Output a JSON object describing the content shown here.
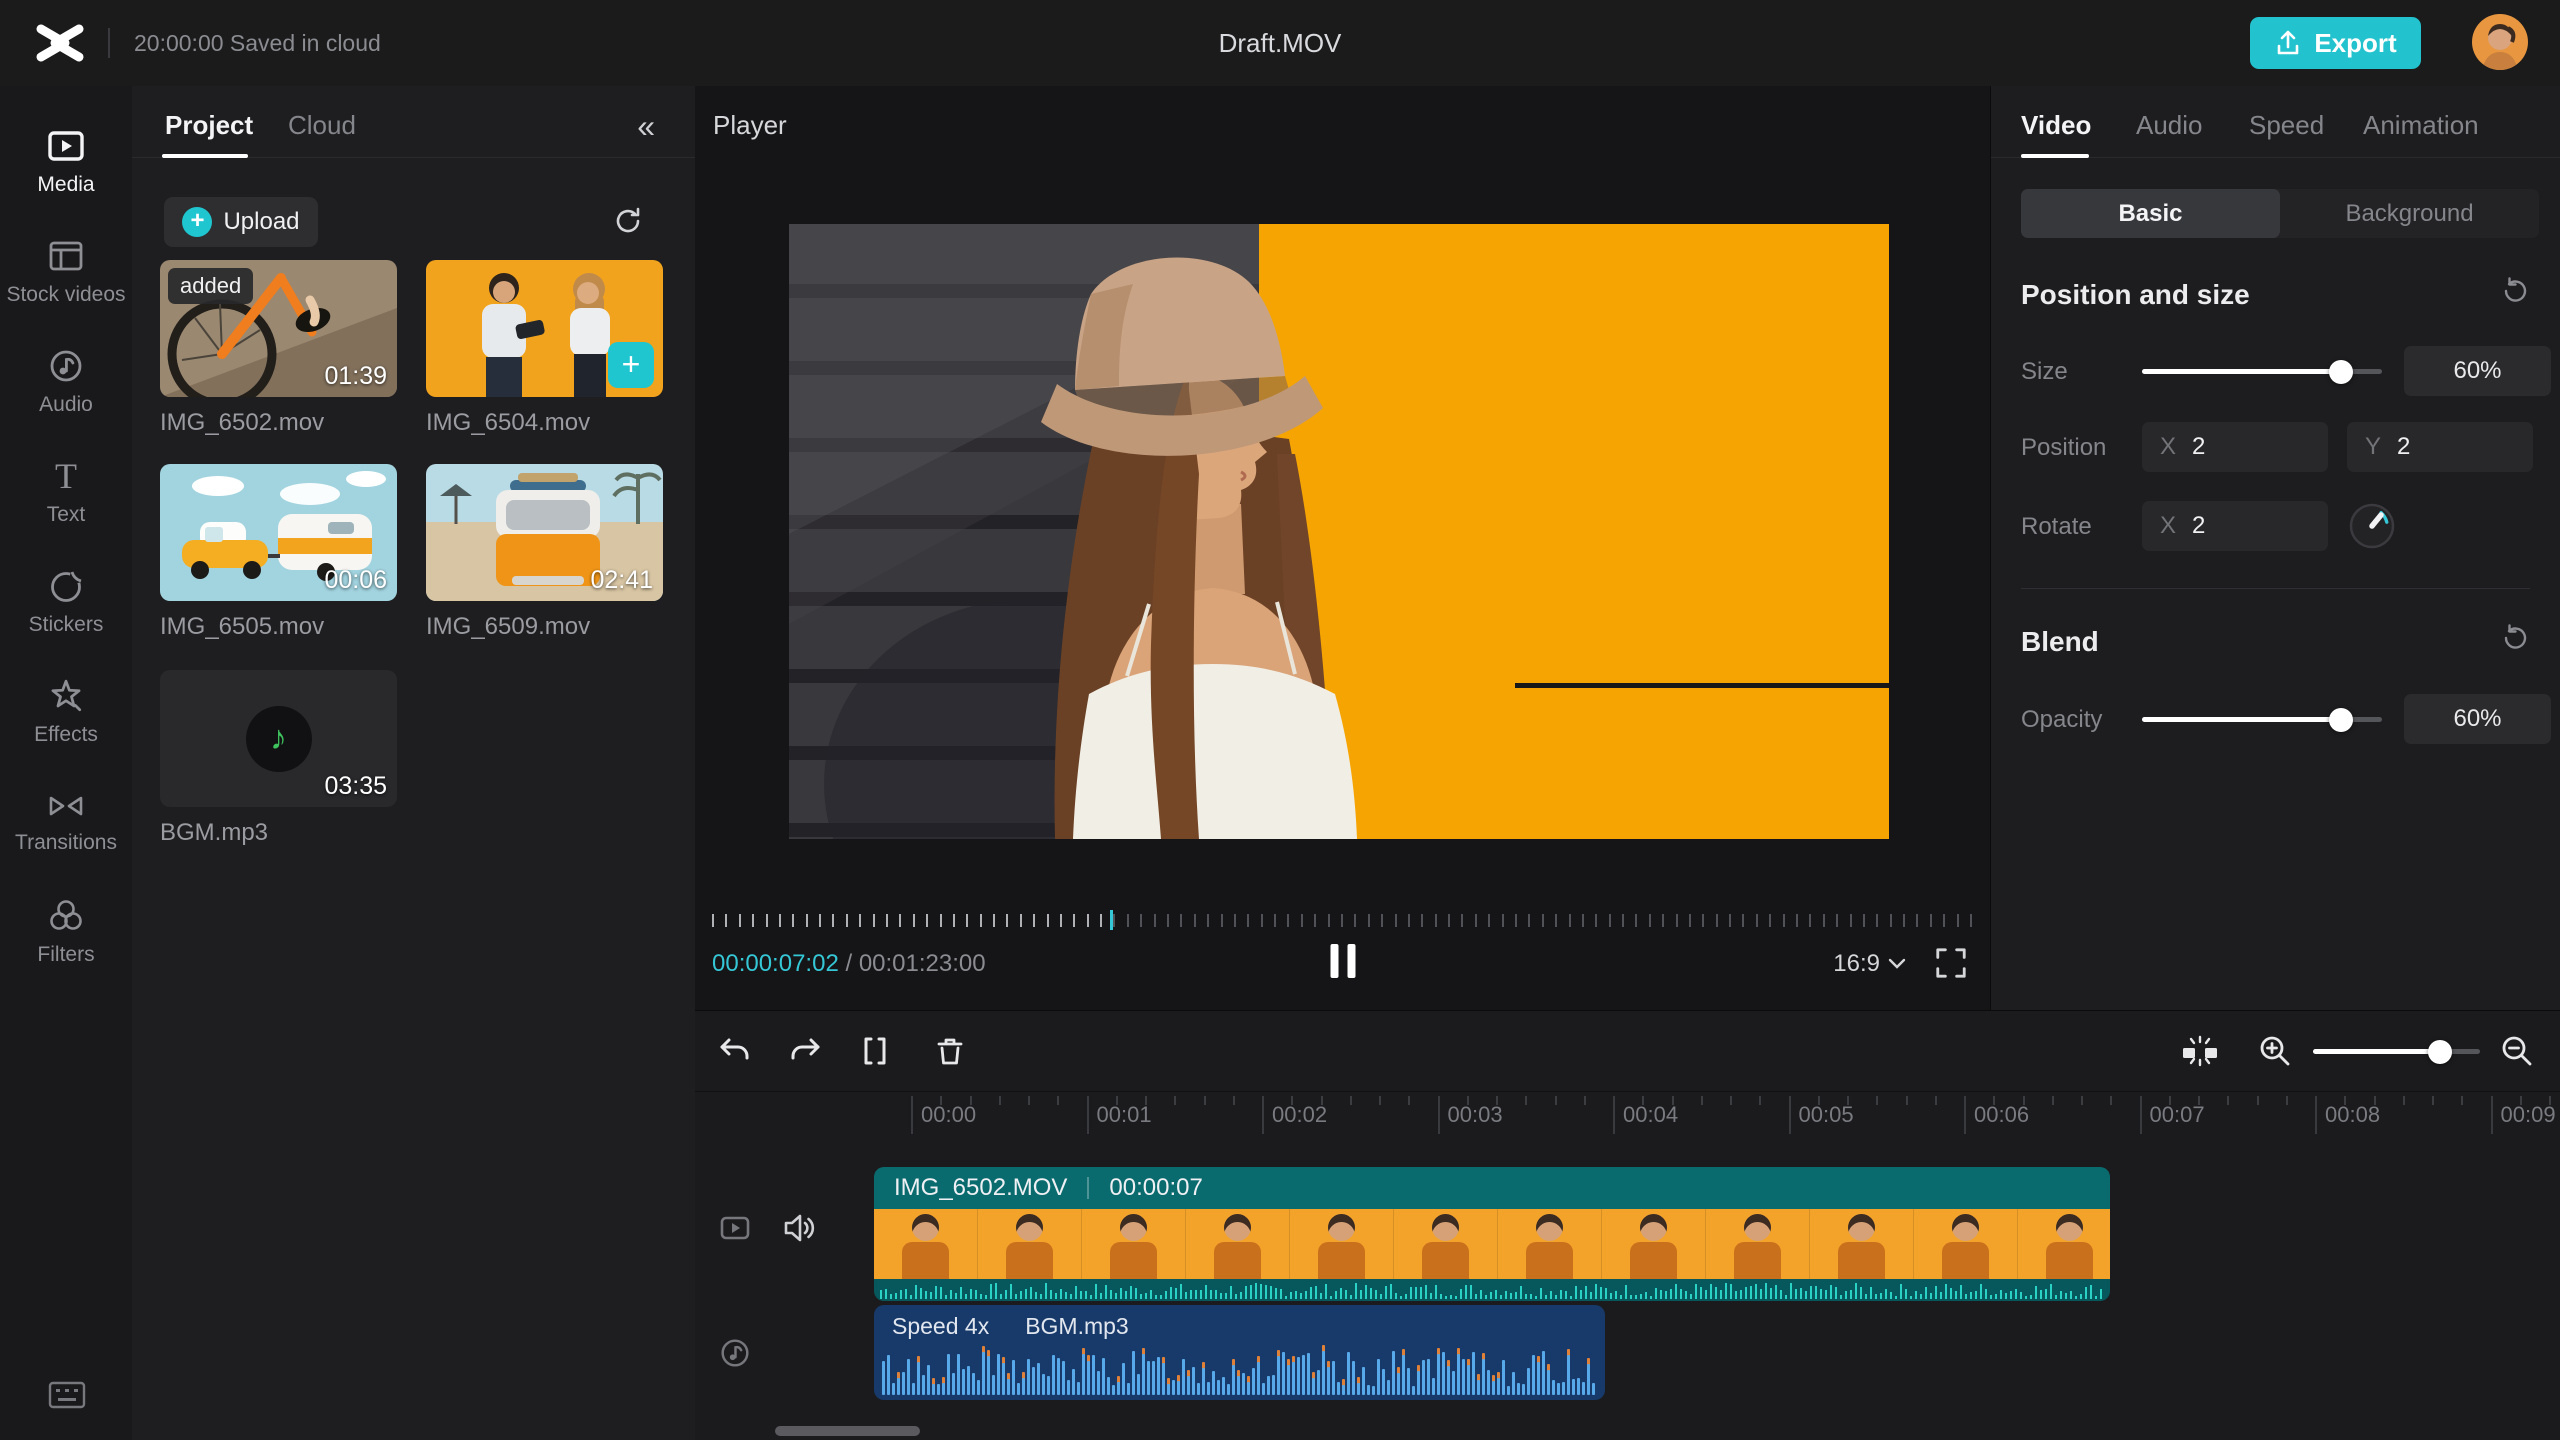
{
  "topbar": {
    "autosave": "20:00:00 Saved in cloud",
    "title": "Draft.MOV",
    "export_label": "Export",
    "accent": "#22c3ce"
  },
  "sidebar": {
    "items": [
      {
        "label": "Media",
        "icon": "media-icon",
        "active": true
      },
      {
        "label": "Stock videos",
        "icon": "stock-videos-icon",
        "active": false
      },
      {
        "label": "Audio",
        "icon": "audio-icon",
        "active": false
      },
      {
        "label": "Text",
        "icon": "text-icon",
        "active": false
      },
      {
        "label": "Stickers",
        "icon": "stickers-icon",
        "active": false
      },
      {
        "label": "Effects",
        "icon": "effects-icon",
        "active": false
      },
      {
        "label": "Transitions",
        "icon": "transitions-icon",
        "active": false
      },
      {
        "label": "Filters",
        "icon": "filters-icon",
        "active": false
      }
    ]
  },
  "media_panel": {
    "tabs": [
      {
        "label": "Project",
        "active": true
      },
      {
        "label": "Cloud",
        "active": false
      }
    ],
    "upload_label": "Upload",
    "items": [
      {
        "name": "IMG_6502.mov",
        "duration": "01:39",
        "badge": "added",
        "type": "video"
      },
      {
        "name": "IMG_6504.mov",
        "duration": "",
        "type": "video",
        "has_add_button": true
      },
      {
        "name": "IMG_6505.mov",
        "duration": "00:06",
        "type": "video"
      },
      {
        "name": "IMG_6509.mov",
        "duration": "02:41",
        "type": "video"
      },
      {
        "name": "BGM.mp3",
        "duration": "03:35",
        "type": "audio"
      }
    ]
  },
  "player": {
    "label": "Player",
    "current_time": "00:00:07:02",
    "separator": " / ",
    "total_time": "00:01:23:00",
    "aspect_ratio": "16:9",
    "progress_pct": 31.6,
    "time_accent": "#35c7d6"
  },
  "inspector": {
    "tabs": [
      {
        "label": "Video",
        "active": true
      },
      {
        "label": "Audio",
        "active": false
      },
      {
        "label": "Speed",
        "active": false
      },
      {
        "label": "Animation",
        "active": false
      }
    ],
    "subtabs": [
      {
        "label": "Basic",
        "active": true
      },
      {
        "label": "Background",
        "active": false
      }
    ],
    "position_size": {
      "title": "Position and size",
      "size_label": "Size",
      "size_value": "60%",
      "size_pct": 83,
      "position_label": "Position",
      "x_label": "X",
      "x_value": "2",
      "y_label": "Y",
      "y_value": "2",
      "rotate_label": "Rotate",
      "rotate_x_label": "X",
      "rotate_value": "2"
    },
    "blend": {
      "title": "Blend",
      "opacity_label": "Opacity",
      "opacity_value": "60%",
      "opacity_pct": 83
    }
  },
  "timeline": {
    "ruler_labels": [
      "00:00",
      "00:01",
      "00:02",
      "00:03",
      "00:04",
      "00:05",
      "00:06",
      "00:07",
      "00:08",
      "00:09"
    ],
    "video_clip": {
      "name": "IMG_6502.MOV",
      "duration": "00:00:07",
      "color": "#0a6b6f"
    },
    "audio_clip": {
      "speed": "Speed 4x",
      "name": "BGM.mp3",
      "color": "#173a6b"
    },
    "zoom_pct": 76
  }
}
